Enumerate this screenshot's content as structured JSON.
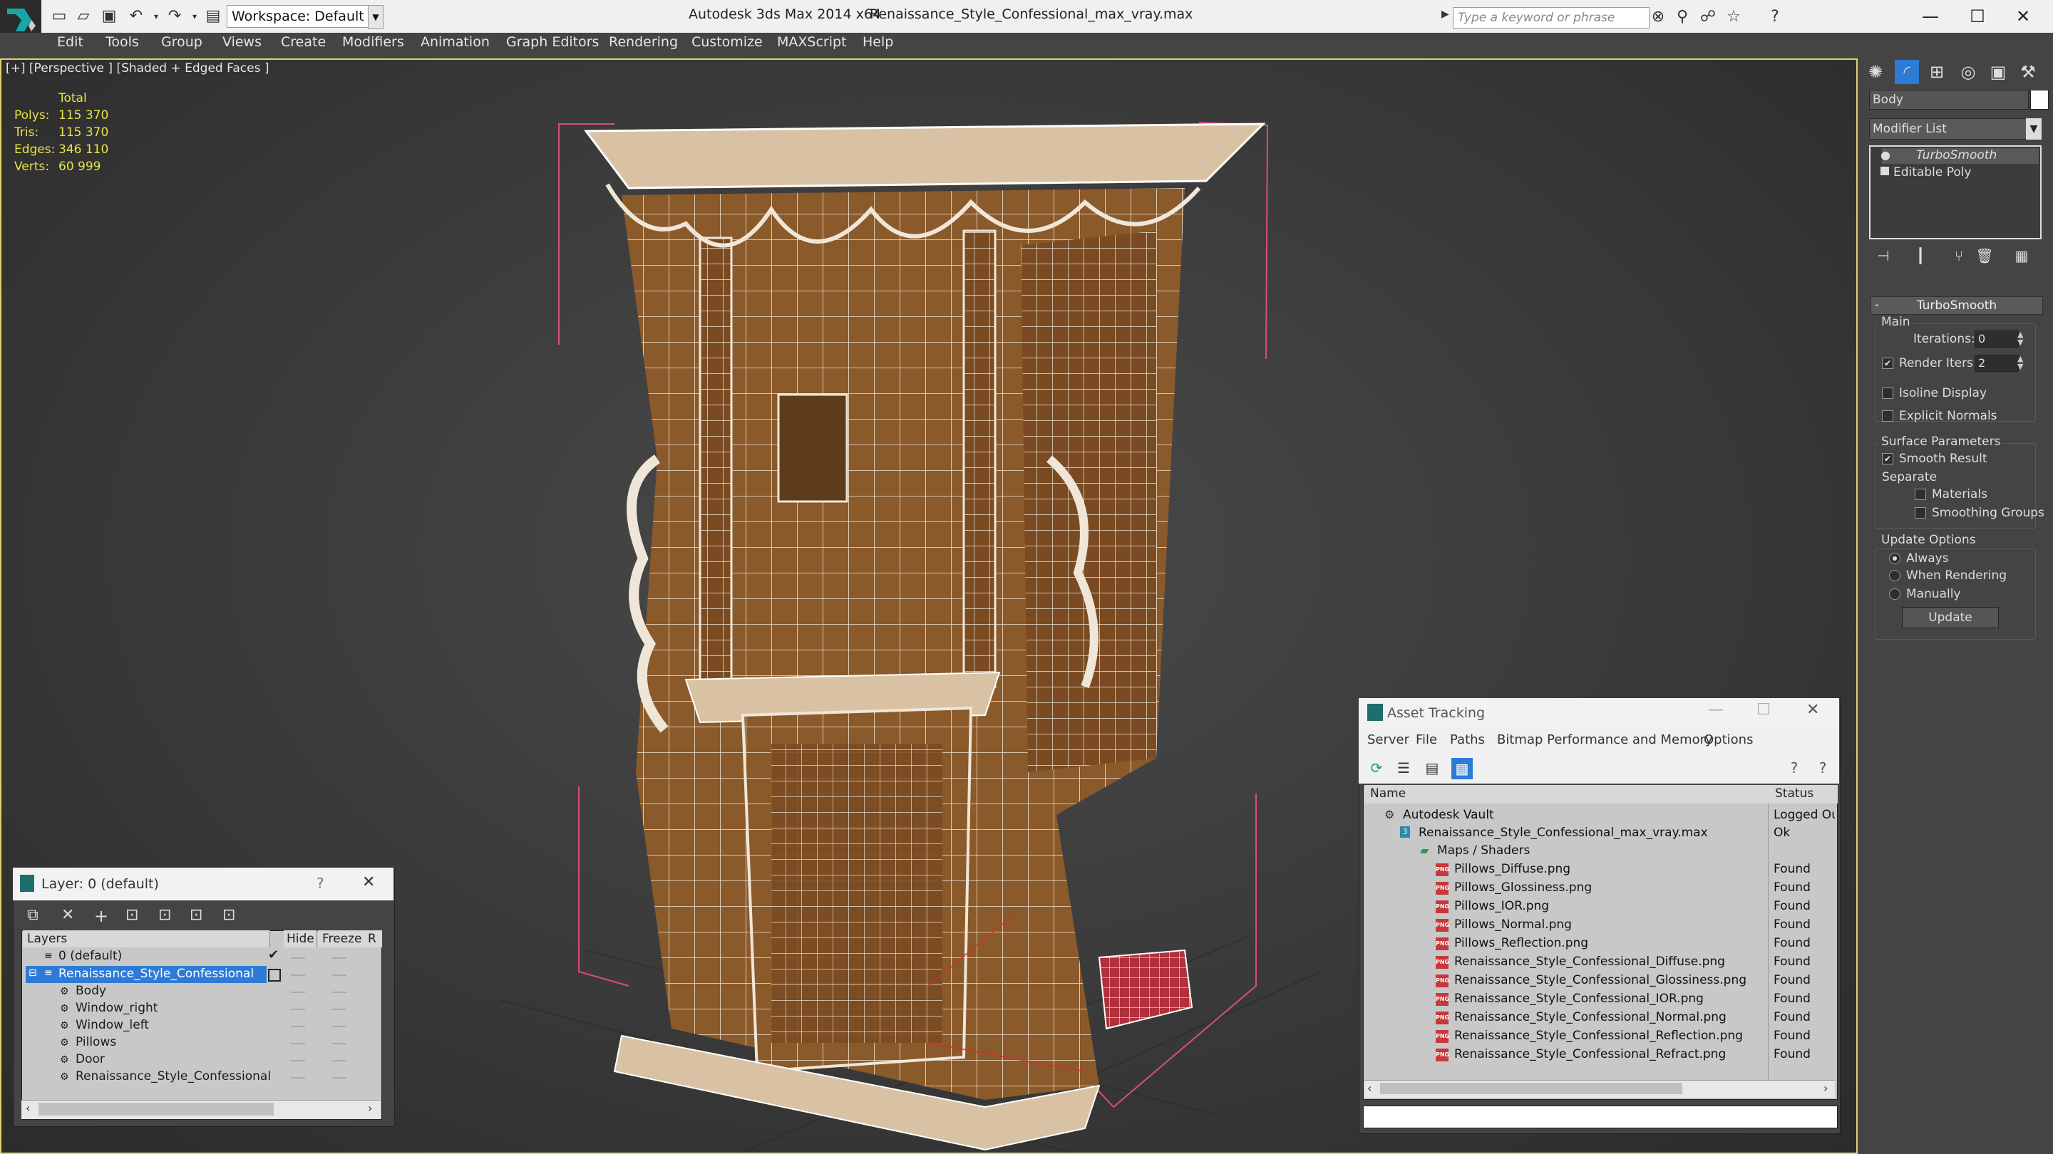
{
  "titlebar": {
    "workspace": "Workspace: Default",
    "app_title": "Autodesk 3ds Max  2014 x64",
    "file_title": "Renaissance_Style_Confessional_max_vray.max",
    "search_placeholder": "Type a keyword or phrase"
  },
  "menu": [
    "Edit",
    "Tools",
    "Group",
    "Views",
    "Create",
    "Modifiers",
    "Animation",
    "Graph Editors",
    "Rendering",
    "Customize",
    "MAXScript",
    "Help"
  ],
  "viewport": {
    "label": "[+] [Perspective ] [Shaded + Edged Faces ]",
    "stats": {
      "header": "Total",
      "rows": [
        {
          "label": "Polys:",
          "value": "115 370"
        },
        {
          "label": "Tris:",
          "value": "115 370"
        },
        {
          "label": "Edges:",
          "value": "346 110"
        },
        {
          "label": "Verts:",
          "value": "60 999"
        }
      ]
    }
  },
  "command_panel": {
    "object_name": "Body",
    "modifier_list": "Modifier List",
    "stack": [
      "TurboSmooth",
      "Editable Poly"
    ],
    "rollout": "TurboSmooth",
    "main_group": "Main",
    "iterations_label": "Iterations:",
    "iterations_value": "0",
    "render_iters_label": "Render Iters:",
    "render_iters_value": "2",
    "isoline_display": "Isoline Display",
    "explicit_normals": "Explicit Normals",
    "surface_group": "Surface Parameters",
    "smooth_result": "Smooth Result",
    "separate_label": "Separate",
    "materials": "Materials",
    "smoothing_groups": "Smoothing Groups",
    "update_group": "Update Options",
    "always": "Always",
    "when_rendering": "When Rendering",
    "manually": "Manually",
    "update_button": "Update"
  },
  "layer_window": {
    "title": "Layer: 0 (default)",
    "help": "?",
    "columns": [
      "Layers",
      "Hide",
      "Freeze",
      "R"
    ],
    "rows": [
      {
        "name": "0 (default)",
        "level": 0
      },
      {
        "name": "Renaissance_Style_Confessional",
        "level": 0
      },
      {
        "name": "Body",
        "level": 1
      },
      {
        "name": "Window_right",
        "level": 1
      },
      {
        "name": "Window_left",
        "level": 1
      },
      {
        "name": "Pillows",
        "level": 1
      },
      {
        "name": "Door",
        "level": 1
      },
      {
        "name": "Renaissance_Style_Confessional",
        "level": 1
      }
    ]
  },
  "asset_tracking": {
    "title": "Asset Tracking",
    "menu": [
      "Server",
      "File",
      "Paths",
      "Bitmap Performance and Memory",
      "Options"
    ],
    "columns": [
      "Name",
      "Status"
    ],
    "rows": [
      {
        "name": "Autodesk Vault",
        "status": "Logged Ou",
        "level": 0,
        "icon": "vault"
      },
      {
        "name": "Renaissance_Style_Confessional_max_vray.max",
        "status": "Ok",
        "level": 1,
        "icon": "max"
      },
      {
        "name": "Maps / Shaders",
        "status": "",
        "level": 2,
        "icon": "maps"
      },
      {
        "name": "Pillows_Diffuse.png",
        "status": "Found",
        "level": 3,
        "icon": "png"
      },
      {
        "name": "Pillows_Glossiness.png",
        "status": "Found",
        "level": 3,
        "icon": "png"
      },
      {
        "name": "Pillows_IOR.png",
        "status": "Found",
        "level": 3,
        "icon": "png"
      },
      {
        "name": "Pillows_Normal.png",
        "status": "Found",
        "level": 3,
        "icon": "png"
      },
      {
        "name": "Pillows_Reflection.png",
        "status": "Found",
        "level": 3,
        "icon": "png"
      },
      {
        "name": "Renaissance_Style_Confessional_Diffuse.png",
        "status": "Found",
        "level": 3,
        "icon": "png"
      },
      {
        "name": "Renaissance_Style_Confessional_Glossiness.png",
        "status": "Found",
        "level": 3,
        "icon": "png"
      },
      {
        "name": "Renaissance_Style_Confessional_IOR.png",
        "status": "Found",
        "level": 3,
        "icon": "png"
      },
      {
        "name": "Renaissance_Style_Confessional_Normal.png",
        "status": "Found",
        "level": 3,
        "icon": "png"
      },
      {
        "name": "Renaissance_Style_Confessional_Reflection.png",
        "status": "Found",
        "level": 3,
        "icon": "png"
      },
      {
        "name": "Renaissance_Style_Confessional_Refract.png",
        "status": "Found",
        "level": 3,
        "icon": "png"
      }
    ]
  },
  "colors": {
    "viewport_border": "#e0d26a",
    "stats_text": "#e8e34a",
    "wood": "#8a5a2a",
    "pillow": "#b0303c",
    "selection": "#2e7bd6"
  }
}
